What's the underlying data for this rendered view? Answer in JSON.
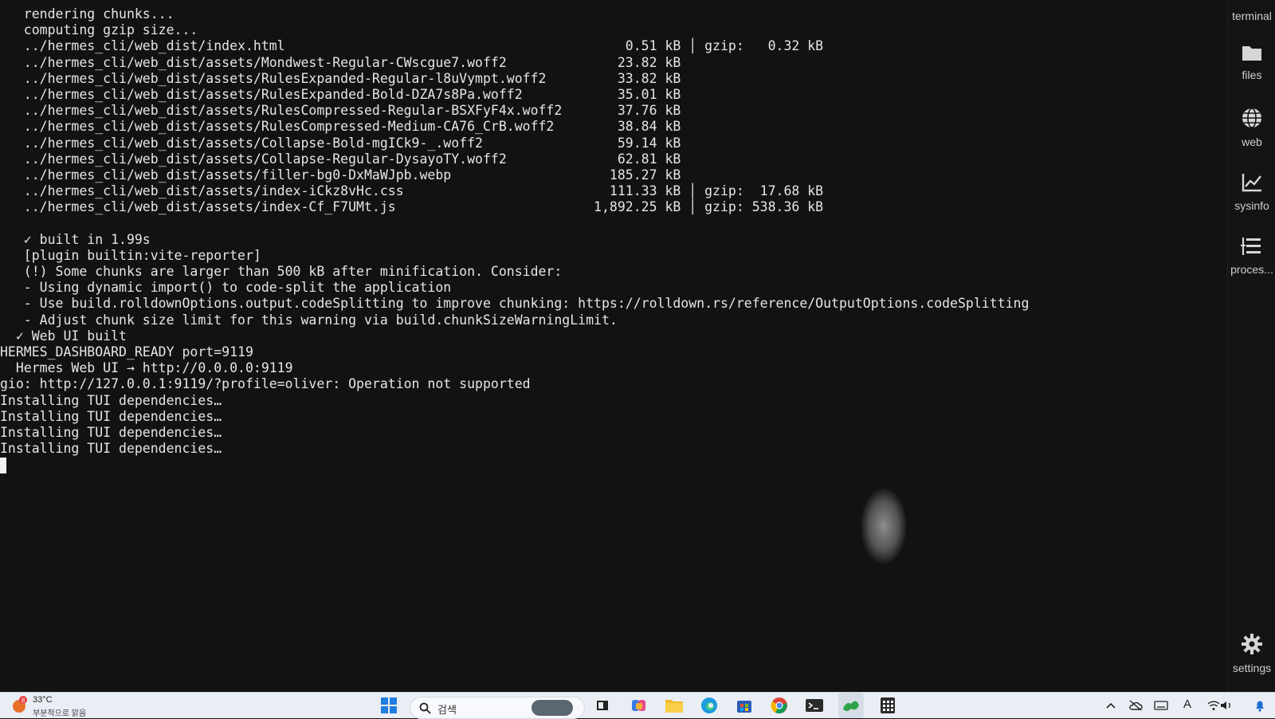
{
  "terminal": {
    "lines": [
      "   rendering chunks...",
      "   computing gzip size...",
      "   ../hermes_cli/web_dist/index.html                                           0.51 kB │ gzip:   0.32 kB",
      "   ../hermes_cli/web_dist/assets/Mondwest-Regular-CWscgue7.woff2              23.82 kB",
      "   ../hermes_cli/web_dist/assets/RulesExpanded-Regular-l8uVympt.woff2         33.82 kB",
      "   ../hermes_cli/web_dist/assets/RulesExpanded-Bold-DZA7s8Pa.woff2            35.01 kB",
      "   ../hermes_cli/web_dist/assets/RulesCompressed-Regular-BSXFyF4x.woff2       37.76 kB",
      "   ../hermes_cli/web_dist/assets/RulesCompressed-Medium-CA76_CrB.woff2        38.84 kB",
      "   ../hermes_cli/web_dist/assets/Collapse-Bold-mgICk9-_.woff2                 59.14 kB",
      "   ../hermes_cli/web_dist/assets/Collapse-Regular-DysayoTY.woff2              62.81 kB",
      "   ../hermes_cli/web_dist/assets/filler-bg0-DxMaWJpb.webp                    185.27 kB",
      "   ../hermes_cli/web_dist/assets/index-iCkz8vHc.css                          111.33 kB │ gzip:  17.68 kB",
      "   ../hermes_cli/web_dist/assets/index-Cf_F7UMt.js                         1,892.25 kB │ gzip: 538.36 kB",
      "",
      "   ✓ built in 1.99s",
      "   [plugin builtin:vite-reporter]",
      "   (!) Some chunks are larger than 500 kB after minification. Consider:",
      "   - Using dynamic import() to code-split the application",
      "   - Use build.rolldownOptions.output.codeSplitting to improve chunking: https://rolldown.rs/reference/OutputOptions.codeSplitting",
      "   - Adjust chunk size limit for this warning via build.chunkSizeWarningLimit.",
      "  ✓ Web UI built",
      "HERMES_DASHBOARD_READY port=9119",
      "  Hermes Web UI → http://0.0.0.0:9119",
      "gio: http://127.0.0.1:9119/?profile=oliver: Operation not supported",
      "Installing TUI dependencies…",
      "Installing TUI dependencies…",
      "Installing TUI dependencies…",
      "Installing TUI dependencies…"
    ]
  },
  "sidebar": {
    "terminal_label": "terminal",
    "files_label": "files",
    "web_label": "web",
    "sysinfo_label": "sysinfo",
    "processes_label": "proces...",
    "settings_label": "settings"
  },
  "taskbar": {
    "weather_badge": "8",
    "weather_temp": "33°C",
    "weather_desc": "부분적으로 맑음",
    "search_placeholder": "검색",
    "tray_lang": "A"
  },
  "colors": {
    "terminal_bg": "#121212",
    "terminal_fg": "#e6e6e6",
    "taskbar_bg": "#e9eef5"
  }
}
